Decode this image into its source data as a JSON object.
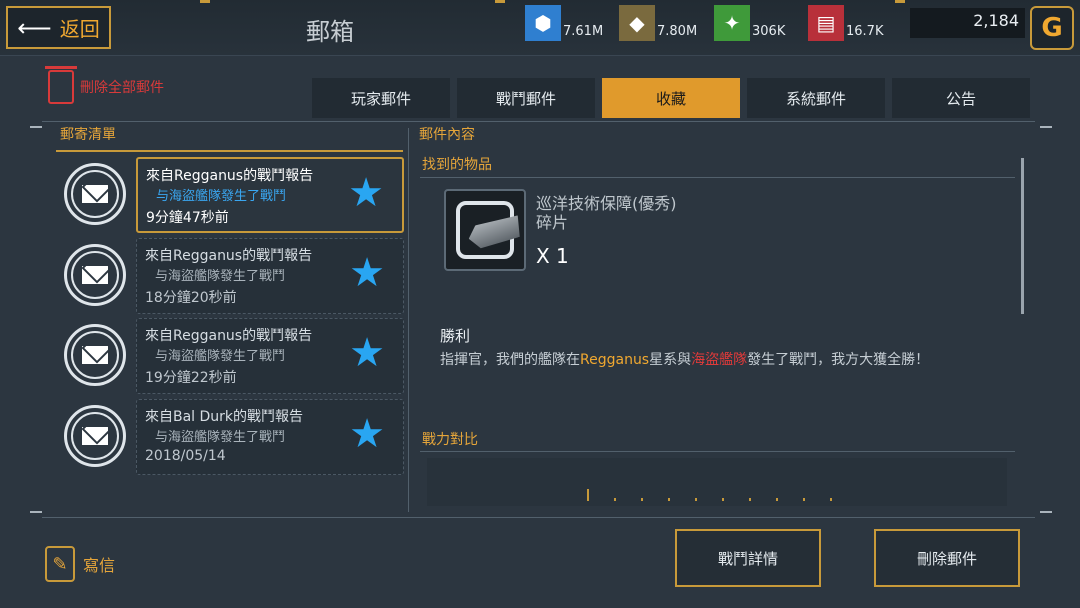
{
  "header": {
    "back_label": "返回",
    "title": "郵箱",
    "resources": [
      {
        "icon": "metal-icon",
        "value": "7.61M",
        "color": "#2f7fd0"
      },
      {
        "icon": "ore-icon",
        "value": "7.80M",
        "color": "#7a6a3e"
      },
      {
        "icon": "crystal-icon",
        "value": "306K",
        "color": "#3f9a3a"
      },
      {
        "icon": "gold-bars-icon",
        "value": "16.7K",
        "color": "#b8303a"
      }
    ],
    "credits": "2,184"
  },
  "toolbar": {
    "delete_all_label": "刪除全部郵件"
  },
  "tabs": [
    {
      "label": "玩家郵件",
      "active": false
    },
    {
      "label": "戰鬥郵件",
      "active": false
    },
    {
      "label": "收藏",
      "active": true
    },
    {
      "label": "系統郵件",
      "active": false
    },
    {
      "label": "公告",
      "active": false
    }
  ],
  "mail_list": {
    "title": "郵寄清單",
    "items": [
      {
        "line1": "來自Regganus的戰鬥報告",
        "line2": "与海盜艦隊發生了戰鬥",
        "line3": "9分鐘47秒前",
        "selected": true
      },
      {
        "line1": "來自Regganus的戰鬥報告",
        "line2": "与海盜艦隊發生了戰鬥",
        "line3": "18分鐘20秒前",
        "selected": false
      },
      {
        "line1": "來自Regganus的戰鬥報告",
        "line2": "与海盜艦隊發生了戰鬥",
        "line3": "19分鐘22秒前",
        "selected": false
      },
      {
        "line1": "來自Bal Durk的戰鬥報告",
        "line2": "与海盜艦隊發生了戰鬥",
        "line3": "2018/05/14",
        "selected": false
      }
    ]
  },
  "content": {
    "title": "郵件內容",
    "found_items_label": "找到的物品",
    "item": {
      "name_line1": "巡洋技術保障(優秀)",
      "name_line2": "碎片",
      "quantity": "X 1"
    },
    "result_title": "勝利",
    "result_text_prefix": "指揮官，我們的艦隊在",
    "result_text_location": "Regganus",
    "result_text_mid": "星系與",
    "result_text_enemy": "海盜艦隊",
    "result_text_suffix": "發生了戰鬥，我方大獲全勝！",
    "compare_label": "戰力對比"
  },
  "footer": {
    "write_label": "寫信",
    "battle_details_label": "戰鬥詳情",
    "delete_mail_label": "刪除郵件"
  }
}
